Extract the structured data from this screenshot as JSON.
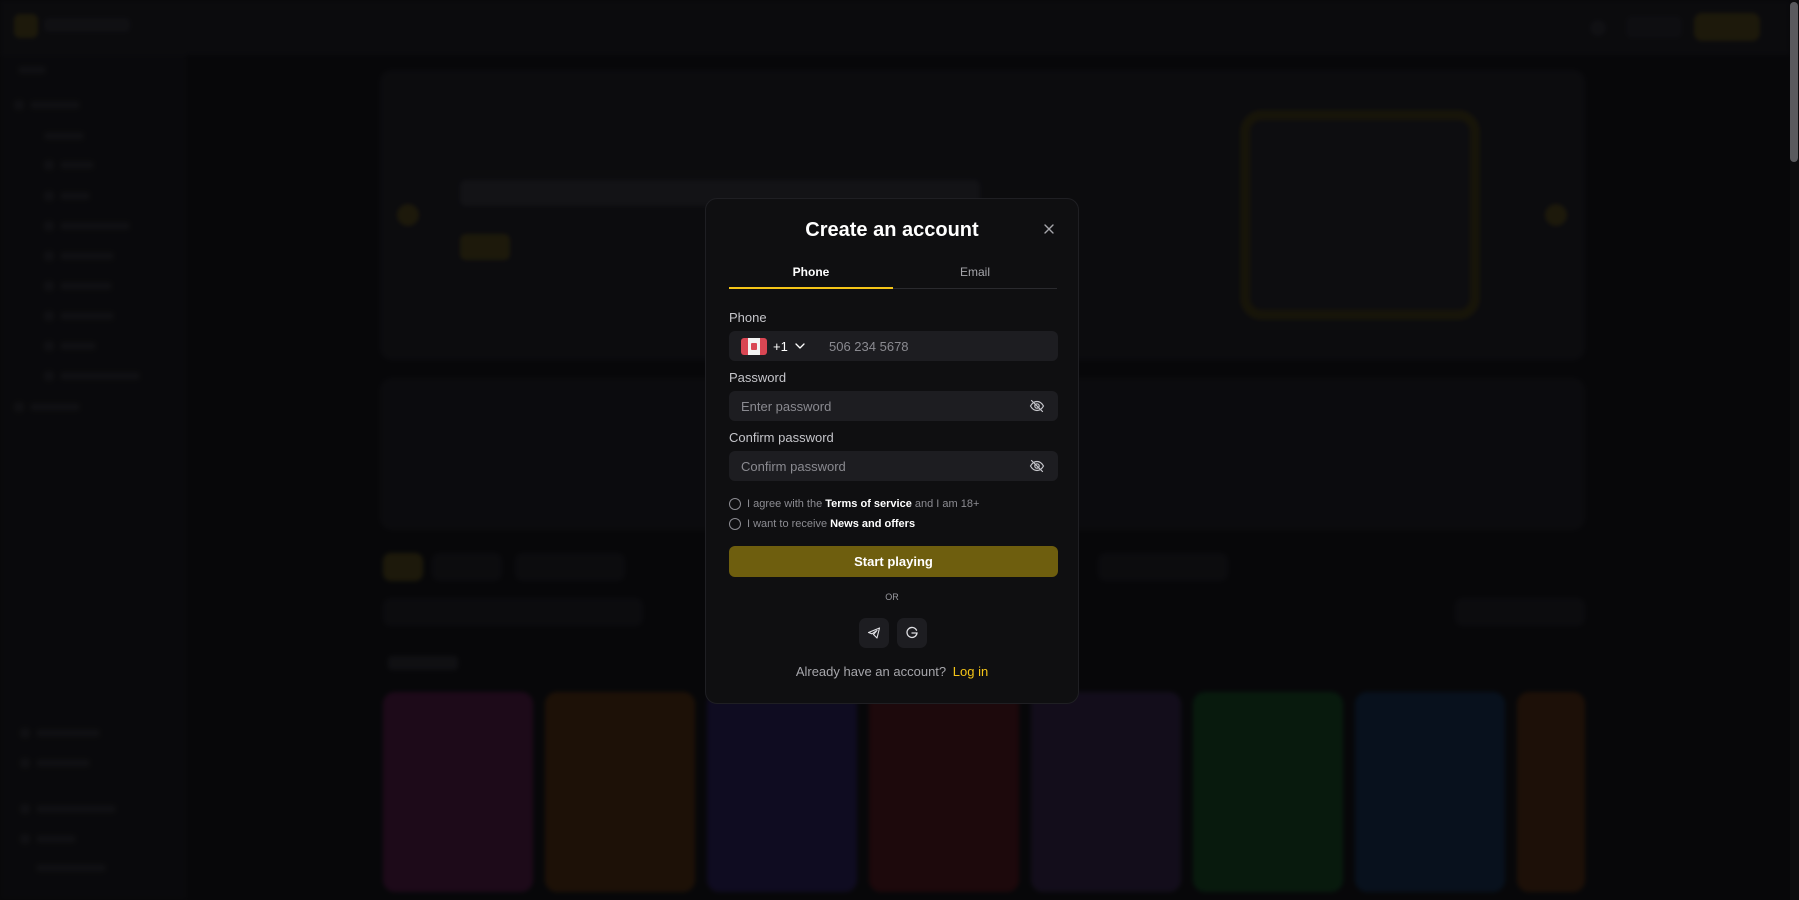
{
  "modal": {
    "title": "Create an account",
    "tabs": [
      {
        "label": "Phone",
        "active": true
      },
      {
        "label": "Email",
        "active": false
      }
    ],
    "phone": {
      "label": "Phone",
      "country_code": "+1",
      "country_flag": "canada-flag-icon",
      "placeholder": "506 234 5678",
      "value": ""
    },
    "password": {
      "label": "Password",
      "placeholder": "Enter password",
      "value": ""
    },
    "confirm_password": {
      "label": "Confirm password",
      "placeholder": "Confirm password",
      "value": ""
    },
    "terms": {
      "pre": "I agree with the",
      "link": "Terms of service",
      "post": "and I am 18+",
      "checked": false
    },
    "news": {
      "pre": "I want to receive",
      "link": "News and offers",
      "checked": false
    },
    "submit_label": "Start playing",
    "or_label": "OR",
    "social": [
      "telegram-icon",
      "google-icon"
    ],
    "login_prompt": "Already have an account?",
    "login_link": "Log in"
  },
  "colors": {
    "accent": "#f5c518",
    "submit_bg": "#6e5e0e",
    "modal_bg": "#0f0f11",
    "input_bg": "#1d1d21"
  }
}
